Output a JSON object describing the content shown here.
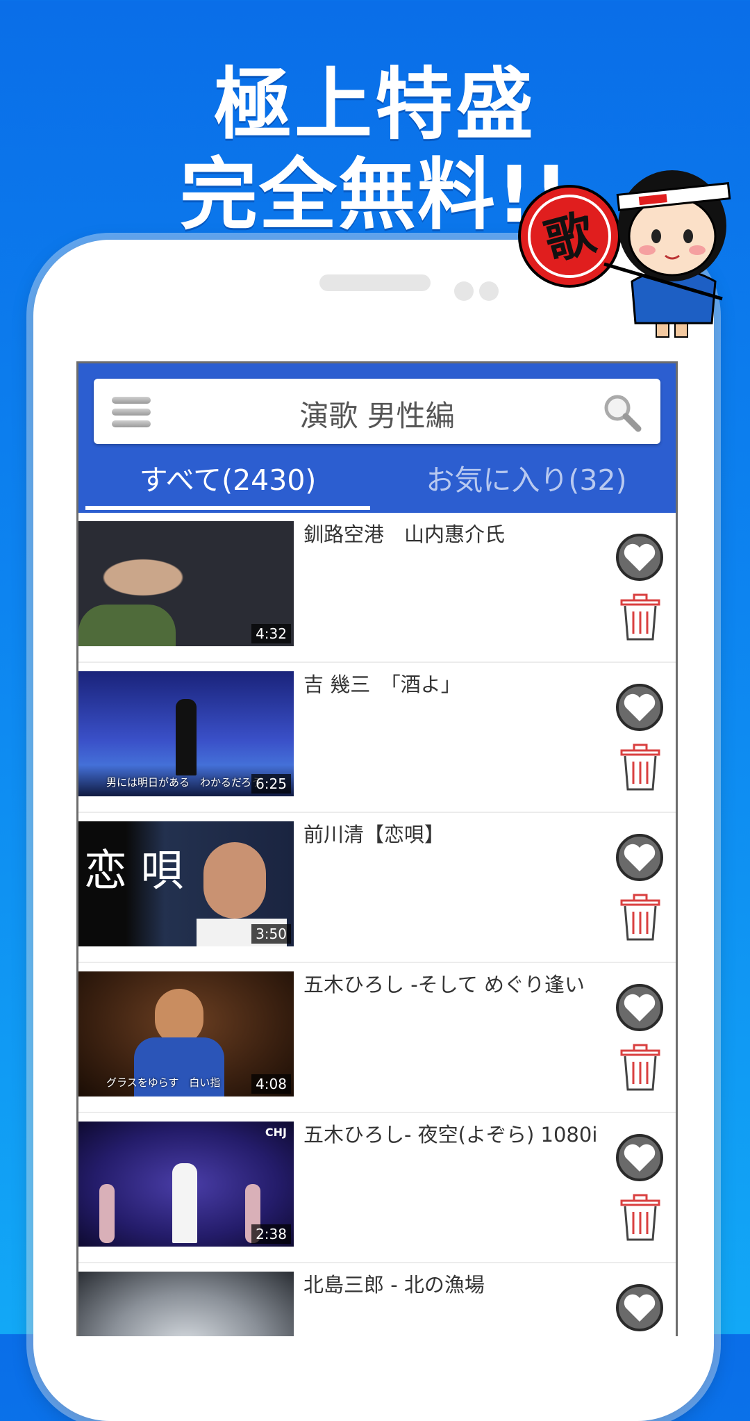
{
  "promo": {
    "line1": "極上特盛",
    "line2": "完全無料!!"
  },
  "mascot": {
    "fan_text": "歌"
  },
  "app": {
    "search_title": "演歌 男性編",
    "tabs": [
      {
        "label": "すべて(2430)",
        "active": true
      },
      {
        "label": "お気に入り(32)",
        "active": false
      }
    ]
  },
  "videos": [
    {
      "title": "釧路空港　山内惠介氏",
      "duration": "4:32",
      "subtitle": ""
    },
    {
      "title": "吉 幾三　「酒よ」",
      "duration": "6:25",
      "subtitle": "男には明日がある　わかるだろう"
    },
    {
      "title": "前川清【恋唄】",
      "duration": "3:50",
      "subtitle": "",
      "overlay_text": "恋 唄"
    },
    {
      "title": "五木ひろし -そして めぐり逢い",
      "duration": "4:08",
      "subtitle": "グラスをゆらす　白い指"
    },
    {
      "title": "五木ひろし- 夜空(よぞら) 1080i",
      "duration": "2:38",
      "subtitle": "",
      "channel_tag": "CHJ"
    },
    {
      "title": "北島三郎 - 北の漁場",
      "duration": "",
      "subtitle": ""
    }
  ],
  "colors": {
    "app_bar": "#2c5ed0",
    "background_top": "#0a6ee8",
    "background_bottom": "#12a8f6",
    "trash": "#d94040"
  }
}
